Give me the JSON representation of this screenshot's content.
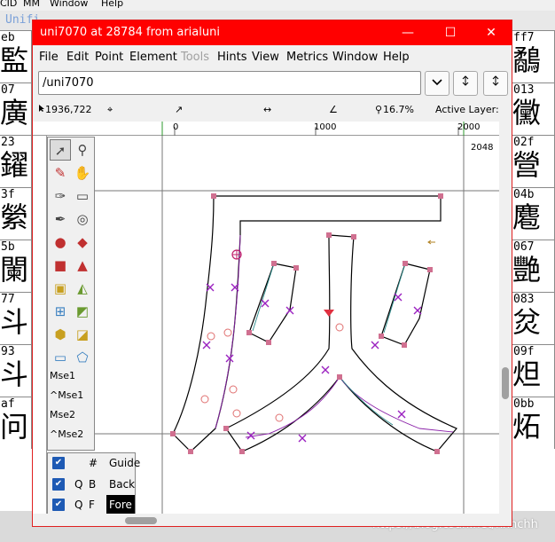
{
  "background_window": {
    "menu": [
      "CID",
      "MM",
      "Window",
      "Help"
    ],
    "title_fragment": "Unifi",
    "left_column": [
      {
        "code": "eb",
        "glyph": "監"
      },
      {
        "code": "07",
        "glyph": "廣"
      },
      {
        "code": "23",
        "glyph": "鑃"
      },
      {
        "code": "3f",
        "glyph": "縈"
      },
      {
        "code": "5b",
        "glyph": "闌"
      },
      {
        "code": "77",
        "glyph": "斗"
      },
      {
        "code": "93",
        "glyph": "斗"
      },
      {
        "code": "af",
        "glyph": "问"
      }
    ],
    "right_column": [
      {
        "code": "ff7",
        "glyph": "鷸"
      },
      {
        "code": "013",
        "glyph": "黴"
      },
      {
        "code": "02f",
        "glyph": "營"
      },
      {
        "code": "04b",
        "glyph": "麅"
      },
      {
        "code": "067",
        "glyph": "艷"
      },
      {
        "code": "083",
        "glyph": "炃"
      },
      {
        "code": "09f",
        "glyph": "炟"
      },
      {
        "code": "0bb",
        "glyph": "炻"
      }
    ],
    "watermark": "https://blog.csdn.net/hxhchh"
  },
  "window": {
    "title": "uni7070 at 28784 from arialuni",
    "controls": {
      "minimize": "—",
      "maximize": "☐",
      "close": "✕"
    },
    "menu": [
      {
        "label": "File",
        "enabled": true
      },
      {
        "label": "Edit",
        "enabled": true
      },
      {
        "label": "Point",
        "enabled": true
      },
      {
        "label": "Element",
        "enabled": true
      },
      {
        "label": "Tools",
        "enabled": false
      },
      {
        "label": "Hints",
        "enabled": true
      },
      {
        "label": "View",
        "enabled": true
      },
      {
        "label": "Metrics",
        "enabled": true
      },
      {
        "label": "Window",
        "enabled": true
      },
      {
        "label": "Help",
        "enabled": true
      }
    ],
    "glyph_name_field": "/uni7070",
    "info": {
      "cursor": "1936,722",
      "zoom": "16.7%",
      "active_layer": "Active Layer: Fore"
    },
    "ruler": {
      "tick0": "0",
      "tick1000": "1000",
      "tick2000": "2000"
    },
    "em_size": "2048",
    "mouse_labels": [
      "Mse1",
      "^Mse1",
      "Mse2",
      "^Mse2"
    ],
    "layers": [
      {
        "q": "",
        "kind": "#",
        "name": "Guide",
        "checked": true,
        "active": false
      },
      {
        "q": "Q",
        "kind": "B",
        "name": "Back",
        "checked": true,
        "active": false
      },
      {
        "q": "Q",
        "kind": "F",
        "name": "Fore",
        "checked": true,
        "active": true
      }
    ],
    "colors": {
      "title_bar": "#ff0000",
      "outline": "#000000",
      "point": "#d07090",
      "control": "#9020b0",
      "guide": "#e05070"
    }
  }
}
